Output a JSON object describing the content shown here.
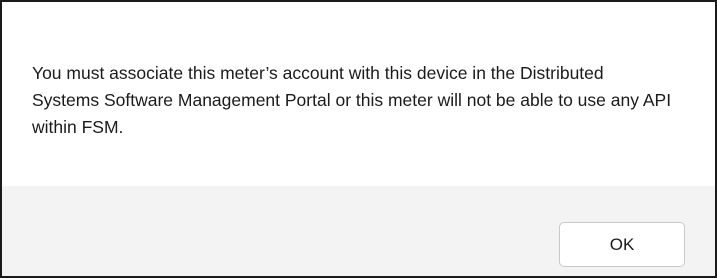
{
  "dialog": {
    "message": "You must associate this meter’s account with this device in the Distributed Systems Software Management Portal or this meter will not be able to use any API within FSM.",
    "ok_label": "OK"
  }
}
